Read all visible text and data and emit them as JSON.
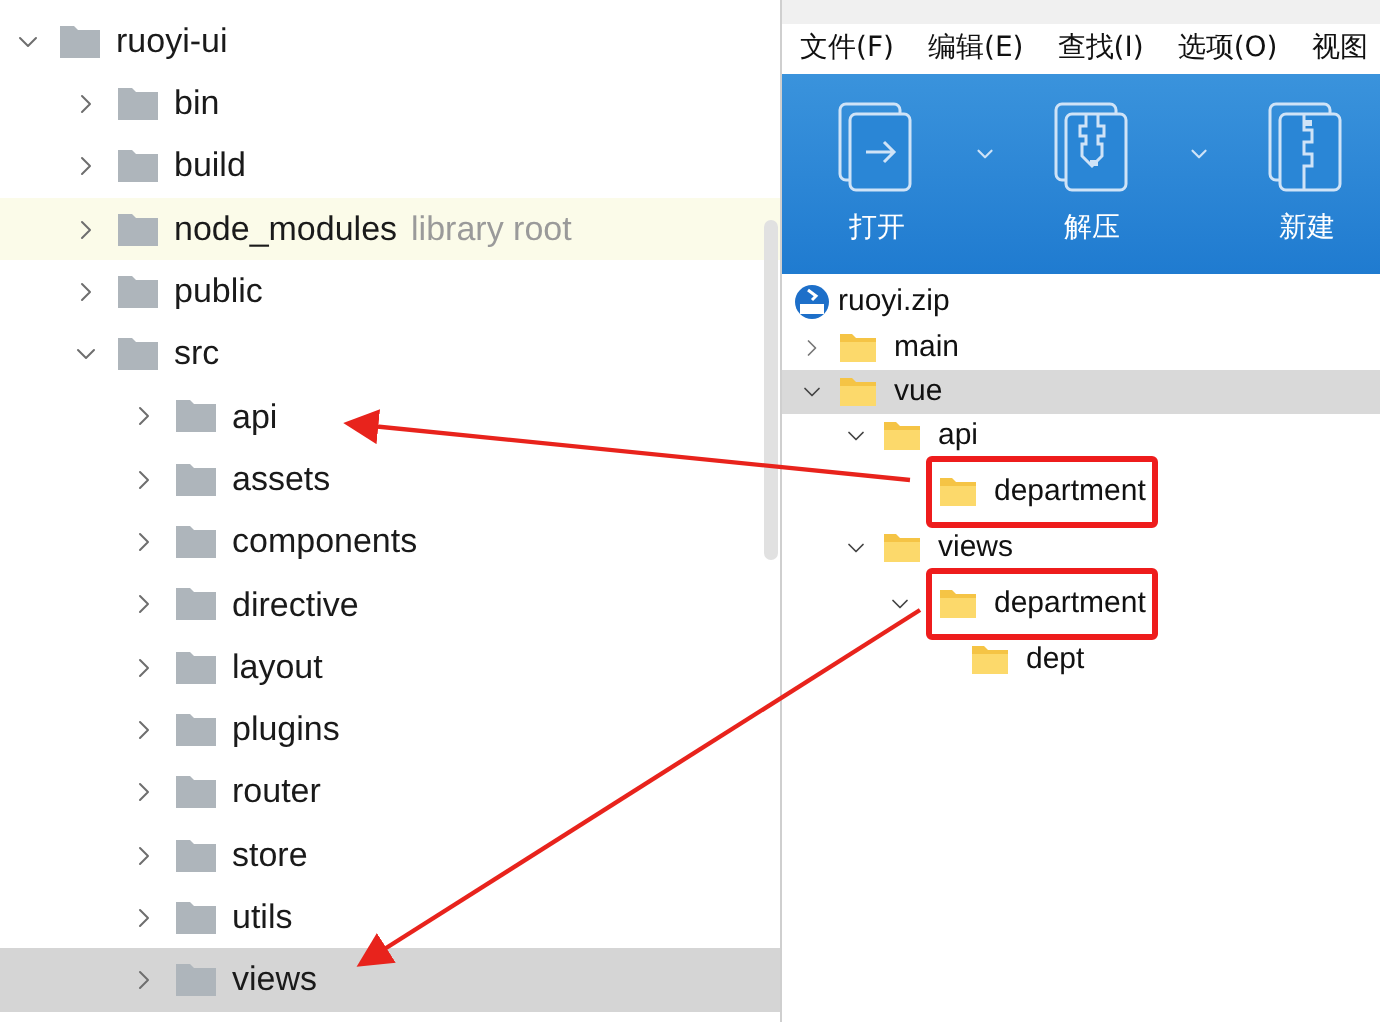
{
  "project_tree": [
    {
      "label": "ruoyi-ui",
      "expanded": true,
      "selected": false,
      "children": [
        {
          "label": "bin",
          "expanded": false,
          "selected": false
        },
        {
          "label": "build",
          "expanded": false,
          "selected": false
        },
        {
          "label": "node_modules",
          "note": "library root",
          "expanded": false,
          "selected": false
        },
        {
          "label": "public",
          "expanded": false,
          "selected": false
        },
        {
          "label": "src",
          "expanded": true,
          "selected": false,
          "children": [
            {
              "label": "api",
              "expanded": false,
              "selected": false
            },
            {
              "label": "assets",
              "expanded": false,
              "selected": false
            },
            {
              "label": "components",
              "expanded": false,
              "selected": false
            },
            {
              "label": "directive",
              "expanded": false,
              "selected": false
            },
            {
              "label": "layout",
              "expanded": false,
              "selected": false
            },
            {
              "label": "plugins",
              "expanded": false,
              "selected": false
            },
            {
              "label": "router",
              "expanded": false,
              "selected": false
            },
            {
              "label": "store",
              "expanded": false,
              "selected": false
            },
            {
              "label": "utils",
              "expanded": false,
              "selected": false
            },
            {
              "label": "views",
              "expanded": false,
              "selected": true
            }
          ]
        }
      ]
    }
  ],
  "archive_window": {
    "menu": [
      "文件(F)",
      "编辑(E)",
      "查找(I)",
      "选项(O)",
      "视图"
    ],
    "toolbar": [
      {
        "label": "打开",
        "kind": "open",
        "dropdown": true
      },
      {
        "label": "解压",
        "kind": "extract",
        "dropdown": true
      },
      {
        "label": "新建",
        "kind": "new",
        "dropdown": false
      }
    ],
    "archive_name": "ruoyi.zip",
    "tree": [
      {
        "label": "main",
        "expanded": false,
        "selected": false,
        "boxed": false
      },
      {
        "label": "vue",
        "expanded": true,
        "selected": true,
        "boxed": false,
        "children": [
          {
            "label": "api",
            "expanded": true,
            "selected": false,
            "boxed": false,
            "children": [
              {
                "label": "department",
                "selected": false,
                "boxed": true
              }
            ]
          },
          {
            "label": "views",
            "expanded": true,
            "selected": false,
            "boxed": false,
            "children": [
              {
                "label": "department",
                "expanded": true,
                "selected": false,
                "boxed": true,
                "children": [
                  {
                    "label": "dept",
                    "selected": false,
                    "boxed": false
                  }
                ]
              }
            ]
          }
        ]
      }
    ]
  }
}
